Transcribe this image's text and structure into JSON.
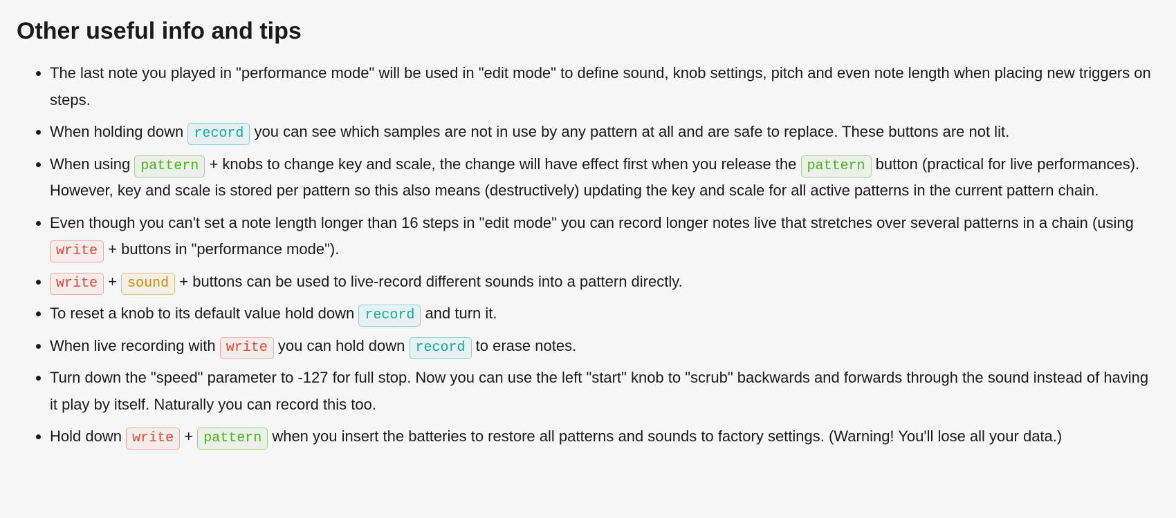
{
  "heading": "Other useful info and tips",
  "keys": {
    "record": "record",
    "pattern": "pattern",
    "write": "write",
    "sound": "sound"
  },
  "tips": {
    "t0": "The last note you played in \"performance mode\" will be used in \"edit mode\" to define sound, knob settings, pitch and even note length when placing new triggers on steps.",
    "t1a": "When holding down ",
    "t1b": " you can see which samples are not in use by any pattern at all and are safe to replace. These buttons are not lit.",
    "t2a": "When using ",
    "t2b": " + knobs to change key and scale, the change will have effect first when you release the ",
    "t2c": " button (practical for live performances). However, key and scale is stored per pattern so this also means (destructively) updating the key and scale for all active patterns in the current pattern chain.",
    "t3a": "Even though you can't set a note length longer than 16 steps in \"edit mode\" you can record longer notes live that stretches over several patterns in a chain (using ",
    "t3b": " + buttons in \"performance mode\").",
    "t4a": "",
    "t4plus1": " + ",
    "t4plus2": " + buttons can be used to live-record different sounds into a pattern directly.",
    "t5a": "To reset a knob to its default value hold down ",
    "t5b": " and turn it.",
    "t6a": "When live recording with ",
    "t6b": " you can hold down ",
    "t6c": " to erase notes.",
    "t7": "Turn down the \"speed\" parameter to -127 for full stop. Now you can use the left \"start\" knob to \"scrub\" backwards and forwards through the sound instead of having it play by itself. Naturally you can record this too.",
    "t8a": "Hold down ",
    "t8plus": " + ",
    "t8b": " when you insert the batteries to restore all patterns and sounds to factory settings. (Warning! You'll lose all your data.)"
  }
}
